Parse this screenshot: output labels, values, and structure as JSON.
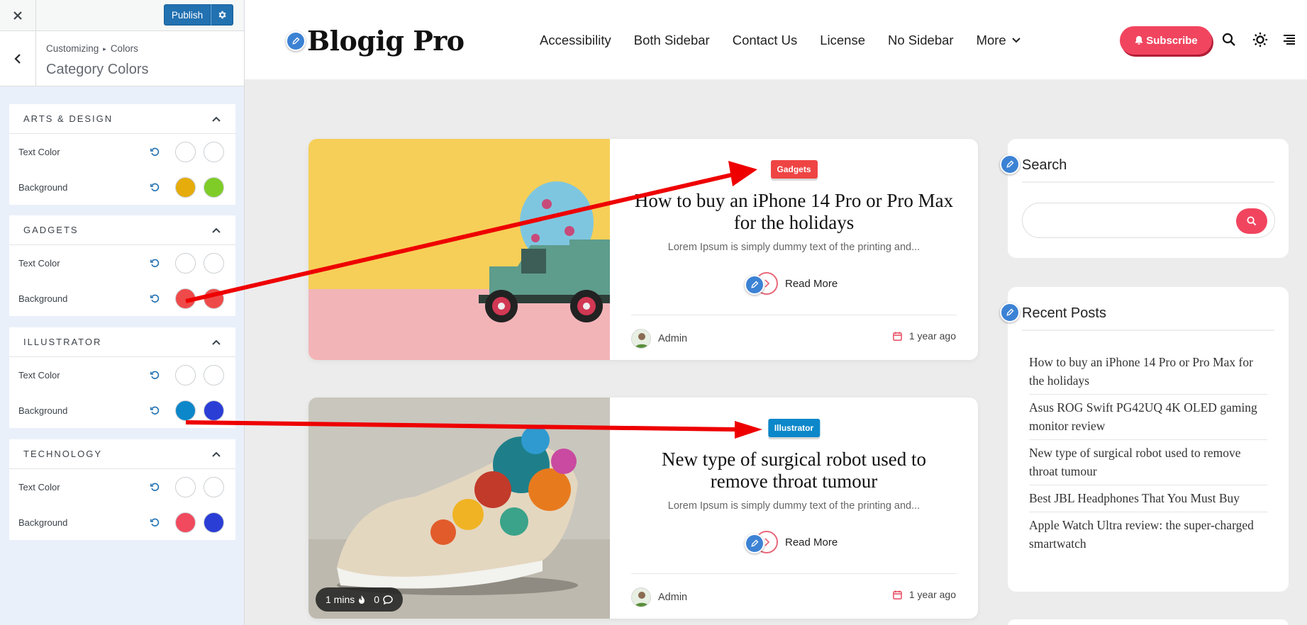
{
  "customizer": {
    "publish_label": "Publish",
    "breadcrumb_parent": "Customizing",
    "breadcrumb_current": "Colors",
    "panel_title": "Category Colors",
    "sections": [
      {
        "title": "ARTS & DESIGN",
        "rows": [
          {
            "label": "Text Color",
            "colors": [
              "#ffffff",
              "#ffffff"
            ]
          },
          {
            "label": "Background",
            "colors": [
              "#e6ac0c",
              "#7fcc28"
            ]
          }
        ]
      },
      {
        "title": "GADGETS",
        "rows": [
          {
            "label": "Text Color",
            "colors": [
              "#ffffff",
              "#ffffff"
            ]
          },
          {
            "label": "Background",
            "colors": [
              "#ef4a4a",
              "#ef4a4a"
            ]
          }
        ]
      },
      {
        "title": "ILLUSTRATOR",
        "rows": [
          {
            "label": "Text Color",
            "colors": [
              "#ffffff",
              "#ffffff"
            ]
          },
          {
            "label": "Background",
            "colors": [
              "#0c87c9",
              "#2a3ed6"
            ]
          }
        ]
      },
      {
        "title": "TECHNOLOGY",
        "rows": [
          {
            "label": "Text Color",
            "colors": [
              "#ffffff",
              "#ffffff"
            ]
          },
          {
            "label": "Background",
            "colors": [
              "#f14a5e",
              "#2a3ed6"
            ]
          }
        ]
      }
    ]
  },
  "site": {
    "logo": "Blogig Pro",
    "nav": [
      "Accessibility",
      "Both Sidebar",
      "Contact Us",
      "License",
      "No Sidebar",
      "More"
    ],
    "subscribe_label": "Subscribe",
    "accent_color": "#f1455f",
    "posts": [
      {
        "category": "Gadgets",
        "category_color": "#ef4444",
        "title": "How to buy an iPhone 14 Pro or Pro Max for the holidays",
        "excerpt": "Lorem Ipsum is simply dummy text of the printing and...",
        "read_more": "Read More",
        "author": "Admin",
        "date": "1 year ago"
      },
      {
        "category": "Illustrator",
        "category_color": "#0c87c9",
        "title": "New type of surgical robot used to remove throat tumour",
        "excerpt": "Lorem Ipsum is simply dummy text of the printing and...",
        "read_more": "Read More",
        "author": "Admin",
        "date": "1 year ago",
        "reading_time": "1 mins",
        "comments": "0"
      }
    ],
    "search_widget_title": "Search",
    "recent_posts_title": "Recent Posts",
    "recent_posts": [
      "How to buy an iPhone 14 Pro or Pro Max for the holidays",
      "Asus ROG Swift PG42UQ 4K OLED gaming monitor review",
      "New type of surgical robot used to remove throat tumour",
      "Best JBL Headphones That You Must Buy",
      "Apple Watch Ultra review: the super-charged smartwatch"
    ]
  }
}
